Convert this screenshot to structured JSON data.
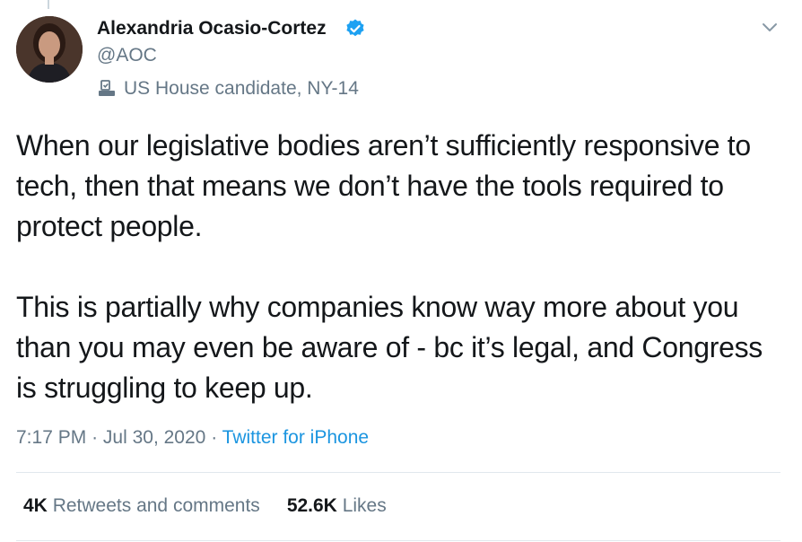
{
  "author": {
    "name": "Alexandria Ocasio-Cortez",
    "handle": "@AOC",
    "label": "US House candidate, NY-14",
    "verified": true
  },
  "icons": {
    "verified": "verified-badge-icon",
    "label": "ballot-box-icon",
    "menu": "chevron-down-icon"
  },
  "tweet": {
    "paragraphs": [
      "When our legislative bodies aren’t sufficiently responsive to tech, then that means we don’t have the tools required to protect people.",
      "This is partially why companies know way more about you than you may even be aware of - bc it’s legal, and Congress is struggling to keep up."
    ]
  },
  "meta": {
    "time": "7:17 PM",
    "separator": "·",
    "date": "Jul 30, 2020",
    "source": "Twitter for iPhone"
  },
  "stats": {
    "retweets_count": "4K",
    "retweets_label": "Retweets and comments",
    "likes_count": "52.6K",
    "likes_label": "Likes"
  },
  "colors": {
    "accent": "#1b95e0",
    "verified": "#1da1f2",
    "secondary_text": "#657786",
    "primary_text": "#14171a"
  }
}
